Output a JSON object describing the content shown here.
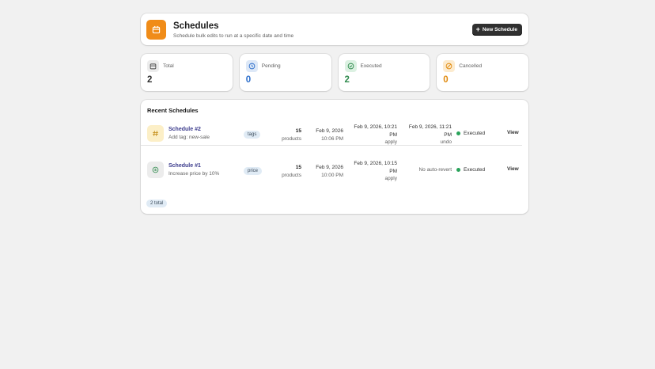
{
  "header": {
    "title": "Schedules",
    "subtitle": "Schedule bulk edits to run at a specific date and time",
    "new_button": "New Schedule",
    "app_icon": "calendar-icon"
  },
  "stats": [
    {
      "label": "Total",
      "value": "2",
      "icon": "calendar-icon",
      "color": "#303030"
    },
    {
      "label": "Pending",
      "value": "0",
      "icon": "clock-icon",
      "color": "#2c6ecb"
    },
    {
      "label": "Executed",
      "value": "2",
      "icon": "check-circle-icon",
      "color": "#2e8a4c"
    },
    {
      "label": "Cancelled",
      "value": "0",
      "icon": "cancel-icon",
      "color": "#e08a0e"
    }
  ],
  "recent": {
    "title": "Recent Schedules",
    "rows": [
      {
        "name": "Schedule #2",
        "description": "Add tag: new-sale",
        "tag": "tags",
        "count": "15",
        "count_unit": "products",
        "scheduled_date": "Feb 9, 2026",
        "scheduled_time": "10:06 PM",
        "apply_line1": "Feb 9, 2026, 10:21",
        "apply_line2": "PM",
        "apply_label": "apply",
        "undo_line1": "Feb 9, 2026, 11:21",
        "undo_line2": "PM",
        "undo_label": "undo",
        "status": "Executed",
        "action": "View"
      },
      {
        "name": "Schedule #1",
        "description": "Increase price by 10%",
        "tag": "price",
        "count": "15",
        "count_unit": "products",
        "scheduled_date": "Feb 9, 2026",
        "scheduled_time": "10:00 PM",
        "apply_line1": "Feb 9, 2026, 10:15",
        "apply_line2": "PM",
        "apply_label": "apply",
        "revert_text": "No auto-revert",
        "status": "Executed",
        "action": "View"
      }
    ],
    "total_badge": "2 total"
  },
  "colors": {
    "accent": "#f08c18",
    "status_executed": "#29a35a"
  }
}
